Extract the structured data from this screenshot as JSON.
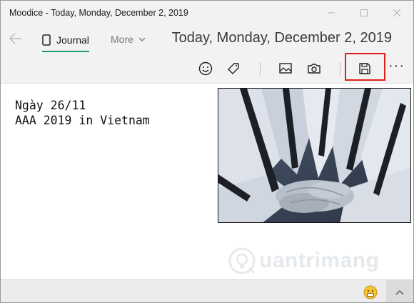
{
  "window": {
    "title": "Moodice - Today, Monday, December 2, 2019"
  },
  "nav": {
    "tab_journal": "Journal",
    "tab_more": "More"
  },
  "header": {
    "date_title": "Today, Monday, December 2, 2019"
  },
  "toolbar": {
    "icons": [
      "emoji-icon",
      "tag-icon",
      "image-icon",
      "camera-icon",
      "save-icon",
      "more-icon"
    ],
    "more_label": "···",
    "highlight_color": "#e0201c"
  },
  "note": {
    "text": "Ngày 26/11\nAAA 2019 in Vietnam"
  },
  "watermark": {
    "text": "uantrimang"
  },
  "colors": {
    "accent": "#1f9a78",
    "chrome": "#f2f2f2"
  }
}
